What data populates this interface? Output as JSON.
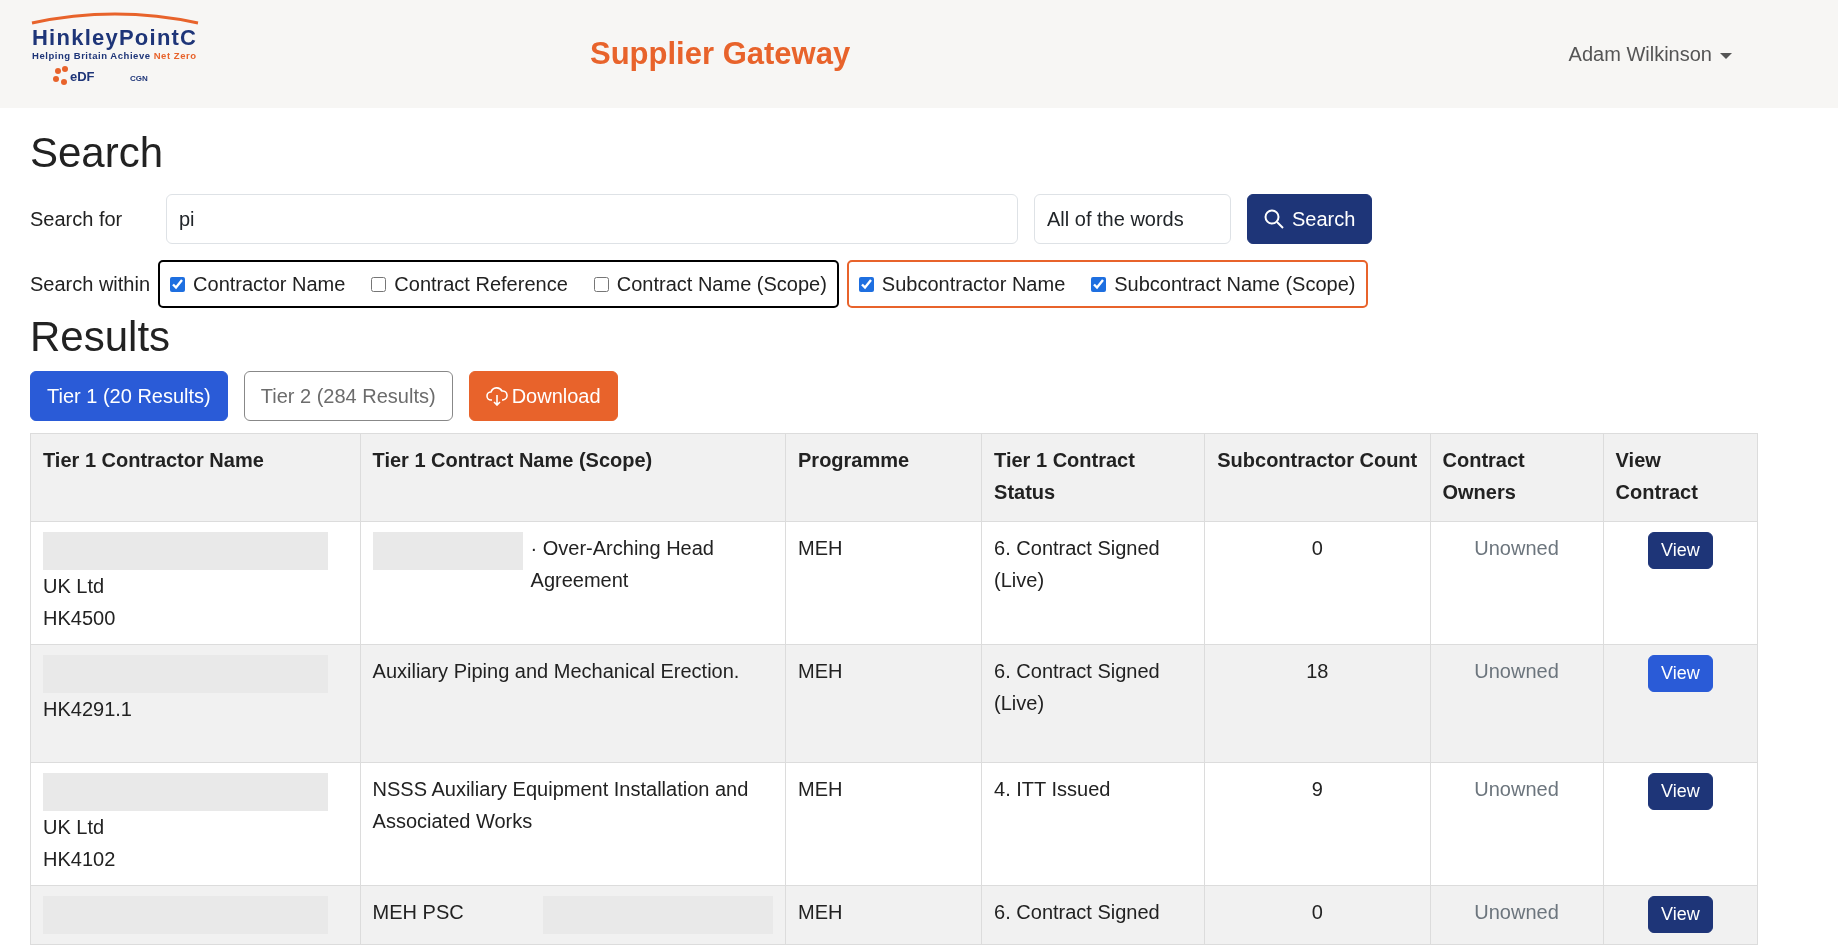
{
  "header": {
    "logo": {
      "name": "HinkleyPointC",
      "tagline": "Helping Britain Achieve",
      "tagline_highlight": "Net Zero",
      "partners": [
        "eDF",
        "CGN"
      ]
    },
    "title": "Supplier Gateway",
    "user": "Adam Wilkinson"
  },
  "search": {
    "heading": "Search",
    "label": "Search for",
    "value": "pi",
    "mode": "All of the words",
    "button": "Search",
    "within_label": "Search within",
    "groups": [
      {
        "color": "#000000",
        "options": [
          {
            "label": "Contractor Name",
            "checked": true
          },
          {
            "label": "Contract Reference",
            "checked": false
          },
          {
            "label": "Contract Name (Scope)",
            "checked": false
          }
        ]
      },
      {
        "color": "#e8632b",
        "options": [
          {
            "label": "Subcontractor Name",
            "checked": true
          },
          {
            "label": "Subcontract Name (Scope)",
            "checked": true
          }
        ]
      }
    ]
  },
  "results": {
    "heading": "Results",
    "tabs": [
      {
        "label": "Tier 1 (20 Results)",
        "selected": true
      },
      {
        "label": "Tier 2 (284 Results)",
        "selected": false
      }
    ],
    "download": "Download"
  },
  "table": {
    "columns": [
      "Tier 1 Contractor Name",
      "Tier 1 Contract Name (Scope)",
      "Programme",
      "Tier 1 Contract Status",
      "Subcontractor Count",
      "Contract Owners",
      "View Contract"
    ],
    "rows": [
      {
        "contractor": [
          {
            "kind": "redaction"
          },
          {
            "kind": "text",
            "text": "UK Ltd"
          },
          {
            "kind": "text",
            "text": "HK4500"
          }
        ],
        "scope": [
          {
            "kind": "redaction"
          },
          {
            "kind": "text",
            "text": "· Over-Arching Head Agreement"
          }
        ],
        "programme": "MEH",
        "status": "6. Contract Signed (Live)",
        "count": "0",
        "owners": "Unowned",
        "view": {
          "label": "View",
          "highlighted": false
        }
      },
      {
        "contractor": [
          {
            "kind": "redaction"
          },
          {
            "kind": "text",
            "text": "HK4291.1"
          }
        ],
        "scope": [
          {
            "kind": "text",
            "text": "Auxiliary Piping and Mechanical Erection."
          }
        ],
        "programme": "MEH",
        "status": "6. Contract Signed (Live)",
        "count": "18",
        "owners": "Unowned",
        "view": {
          "label": "View",
          "highlighted": true
        }
      },
      {
        "contractor": [
          {
            "kind": "redaction"
          },
          {
            "kind": "text",
            "text": "UK Ltd"
          },
          {
            "kind": "text",
            "text": "HK4102"
          }
        ],
        "scope": [
          {
            "kind": "text",
            "text": "NSSS Auxiliary Equipment Installation and Associated Works"
          }
        ],
        "programme": "MEH",
        "status": "4. ITT Issued",
        "count": "9",
        "owners": "Unowned",
        "view": {
          "label": "View",
          "highlighted": false
        }
      },
      {
        "contractor": [
          {
            "kind": "redaction"
          }
        ],
        "scope": [
          {
            "kind": "text",
            "text": "MEH PSC"
          },
          {
            "kind": "redaction"
          }
        ],
        "programme": "MEH",
        "status": "6. Contract Signed",
        "count": "0",
        "owners": "Unowned",
        "view": {
          "label": "View",
          "highlighted": false
        }
      }
    ]
  }
}
